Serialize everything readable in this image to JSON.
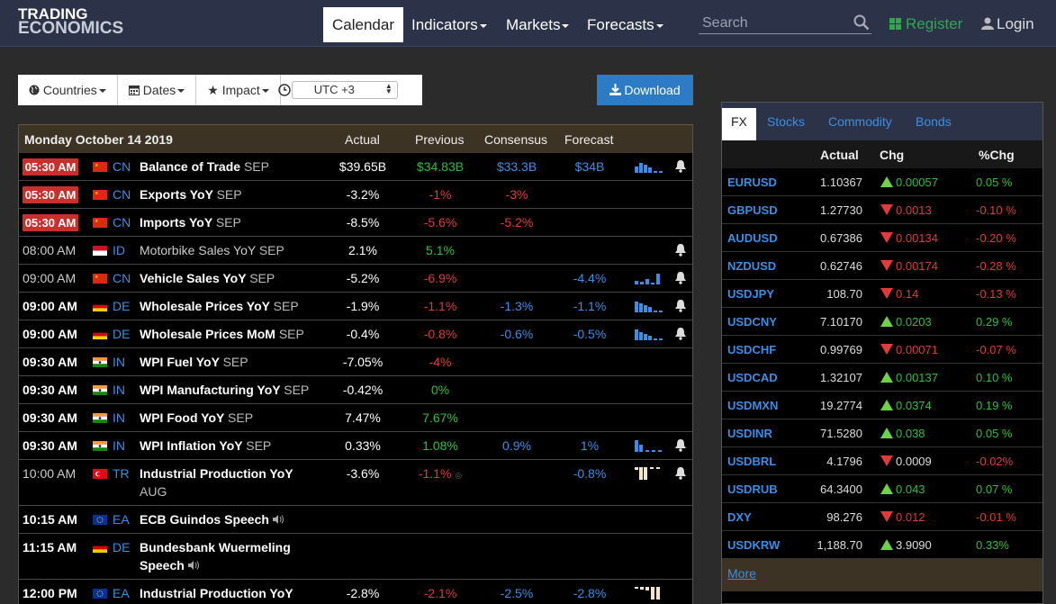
{
  "brand": {
    "line1": "TRADING",
    "line2": "ECONOMICS"
  },
  "nav": {
    "calendar": "Calendar",
    "indicators": "Indicators",
    "markets": "Markets",
    "forecasts": "Forecasts"
  },
  "search": {
    "placeholder": "Search"
  },
  "auth": {
    "register": "Register",
    "login": "Login"
  },
  "toolbar": {
    "countries": "Countries",
    "dates": "Dates",
    "impact": "Impact",
    "timezone": "UTC +3",
    "download": "Download"
  },
  "calendar": {
    "date": "Monday October 14 2019",
    "columns": {
      "actual": "Actual",
      "previous": "Previous",
      "consensus": "Consensus",
      "forecast": "Forecast"
    },
    "rows": [
      {
        "time": "05:30 AM",
        "country": "CN",
        "event": "Balance of Trade",
        "period": "SEP",
        "actual": "$39.65B",
        "previous": "$34.83B",
        "consensus": "$33.3B",
        "forecast": "$34B"
      },
      {
        "time": "05:30 AM",
        "country": "CN",
        "event": "Exports YoY",
        "period": "SEP",
        "actual": "-3.2%",
        "previous": "-1%",
        "consensus": "-3%",
        "forecast": ""
      },
      {
        "time": "05:30 AM",
        "country": "CN",
        "event": "Imports YoY",
        "period": "SEP",
        "actual": "-8.5%",
        "previous": "-5.6%",
        "consensus": "-5.2%",
        "forecast": ""
      },
      {
        "time": "08:00 AM",
        "country": "ID",
        "event": "Motorbike Sales YoY",
        "period": "SEP",
        "actual": "2.1%",
        "previous": "5.1%",
        "consensus": "",
        "forecast": ""
      },
      {
        "time": "09:00 AM",
        "country": "CN",
        "event": "Vehicle Sales YoY",
        "period": "SEP",
        "actual": "-5.2%",
        "previous": "-6.9%",
        "consensus": "",
        "forecast": "-4.4%"
      },
      {
        "time": "09:00 AM",
        "country": "DE",
        "event": "Wholesale Prices YoY",
        "period": "SEP",
        "actual": "-1.9%",
        "previous": "-1.1%",
        "consensus": "-1.3%",
        "forecast": "-1.1%"
      },
      {
        "time": "09:00 AM",
        "country": "DE",
        "event": "Wholesale Prices MoM",
        "period": "SEP",
        "actual": "-0.4%",
        "previous": "-0.8%",
        "consensus": "-0.6%",
        "forecast": "-0.5%"
      },
      {
        "time": "09:30 AM",
        "country": "IN",
        "event": "WPI Fuel YoY",
        "period": "SEP",
        "actual": "-7.05%",
        "previous": "-4%",
        "consensus": "",
        "forecast": ""
      },
      {
        "time": "09:30 AM",
        "country": "IN",
        "event": "WPI Manufacturing YoY",
        "period": "SEP",
        "actual": "-0.42%",
        "previous": "0%",
        "consensus": "",
        "forecast": ""
      },
      {
        "time": "09:30 AM",
        "country": "IN",
        "event": "WPI Food YoY",
        "period": "SEP",
        "actual": "7.47%",
        "previous": "7.67%",
        "consensus": "",
        "forecast": ""
      },
      {
        "time": "09:30 AM",
        "country": "IN",
        "event": "WPI Inflation YoY",
        "period": "SEP",
        "actual": "0.33%",
        "previous": "1.08%",
        "consensus": "0.9%",
        "forecast": "1%"
      },
      {
        "time": "10:00 AM",
        "country": "TR",
        "event": "Industrial Production YoY",
        "period": "AUG",
        "actual": "-3.6%",
        "previous": "-1.1%",
        "consensus": "",
        "forecast": "-0.8%"
      },
      {
        "time": "10:15 AM",
        "country": "EA",
        "event": "ECB Guindos Speech",
        "period": "",
        "actual": "",
        "previous": "",
        "consensus": "",
        "forecast": ""
      },
      {
        "time": "11:15 AM",
        "country": "DE",
        "event": "Bundesbank Wuermeling",
        "event2": "Speech",
        "period": "",
        "actual": "",
        "previous": "",
        "consensus": "",
        "forecast": ""
      },
      {
        "time": "12:00 PM",
        "country": "EA",
        "event": "Industrial Production YoY",
        "period": "",
        "actual": "-2.8%",
        "previous": "-2.1%",
        "consensus": "-2.5%",
        "forecast": "-2.8%"
      }
    ]
  },
  "fx": {
    "tabs": [
      "FX",
      "Stocks",
      "Commodity",
      "Bonds"
    ],
    "columns": {
      "actual": "Actual",
      "chg": "Chg",
      "pct": "%Chg"
    },
    "rows": [
      {
        "symbol": "EURUSD",
        "actual": "1.10367",
        "chg": "0.00057",
        "pct": "0.05 %",
        "dir": "up"
      },
      {
        "symbol": "GBPUSD",
        "actual": "1.27730",
        "chg": "0.0013",
        "pct": "-0.10 %",
        "dir": "down"
      },
      {
        "symbol": "AUDUSD",
        "actual": "0.67386",
        "chg": "0.00134",
        "pct": "-0.20 %",
        "dir": "down"
      },
      {
        "symbol": "NZDUSD",
        "actual": "0.62746",
        "chg": "0.00174",
        "pct": "-0.28 %",
        "dir": "down"
      },
      {
        "symbol": "USDJPY",
        "actual": "108.70",
        "chg": "0.14",
        "pct": "-0.13 %",
        "dir": "down"
      },
      {
        "symbol": "USDCNY",
        "actual": "7.10170",
        "chg": "0.0203",
        "pct": "0.29 %",
        "dir": "up"
      },
      {
        "symbol": "USDCHF",
        "actual": "0.99769",
        "chg": "0.00071",
        "pct": "-0.07 %",
        "dir": "down"
      },
      {
        "symbol": "USDCAD",
        "actual": "1.32107",
        "chg": "0.00137",
        "pct": "0.10 %",
        "dir": "up"
      },
      {
        "symbol": "USDMXN",
        "actual": "19.2774",
        "chg": "0.0374",
        "pct": "0.19 %",
        "dir": "up"
      },
      {
        "symbol": "USDINR",
        "actual": "71.5280",
        "chg": "0.038",
        "pct": "0.05 %",
        "dir": "up"
      },
      {
        "symbol": "USDBRL",
        "actual": "4.1796",
        "chg": "0.0009",
        "pct": "-0.02%",
        "dir": "down"
      },
      {
        "symbol": "USDRUB",
        "actual": "64.3400",
        "chg": "0.043",
        "pct": "0.07 %",
        "dir": "up"
      },
      {
        "symbol": "DXY",
        "actual": "98.276",
        "chg": "0.012",
        "pct": "-0.01 %",
        "dir": "down"
      },
      {
        "symbol": "USDKRW",
        "actual": "1,188.70",
        "chg": "3.9090",
        "pct": "0.33%",
        "dir": "up"
      }
    ],
    "more": "More"
  }
}
